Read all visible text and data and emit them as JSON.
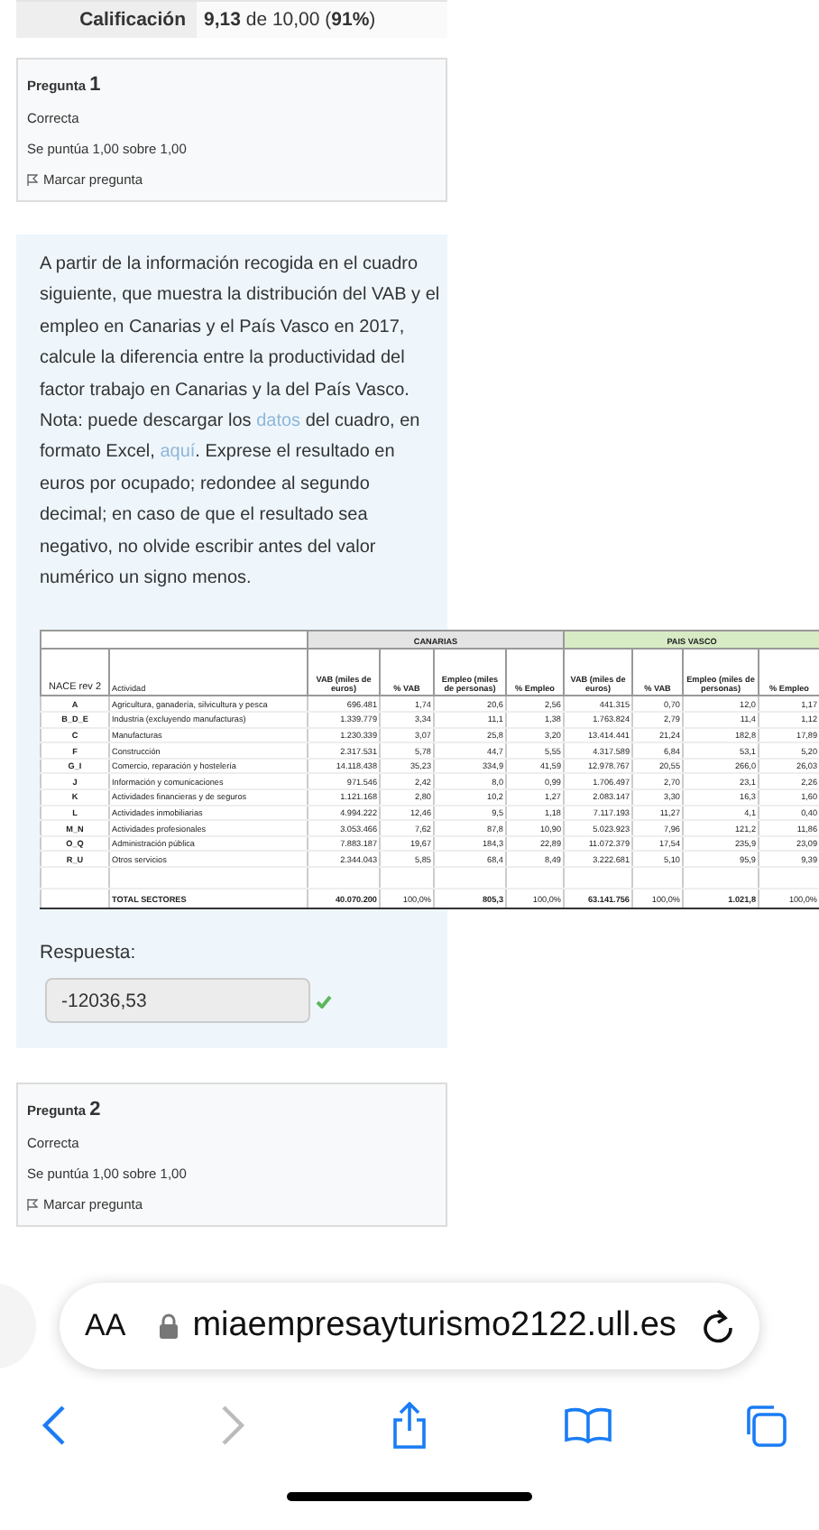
{
  "grade": {
    "label": "Calificación",
    "value": "**9,13** de 10,00 (**91%**)"
  },
  "question1": {
    "label": "Pregunta",
    "number": "1",
    "status": "Correcta",
    "score": "Se puntúa 1,00 sobre 1,00",
    "flag": "Marcar pregunta"
  },
  "prompt": [
    {
      "kind": "text",
      "text": "A partir de la información recogida en el cuadro siguiente, que muestra la distribución del VAB y el empleo en Canarias y el País Vasco en 2017, calcule la diferencia entre la productividad del factor trabajo en Canarias y la del País Vasco. Nota: puede descargar los "
    },
    {
      "kind": "link",
      "text": "datos"
    },
    {
      "kind": "text",
      "text": " del cuadro, en formato Excel, "
    },
    {
      "kind": "link",
      "text": "aquí"
    },
    {
      "kind": "text",
      "text": ". Exprese el resultado en euros por ocupado; redondee al segundo decimal; en caso de que el resultado sea negativo, no olvide escribir antes del valor numérico un signo menos."
    }
  ],
  "table": {
    "groups": [
      {
        "label": "CANARIAS",
        "kind": "grey"
      },
      {
        "label": "PAIS VASCO",
        "kind": "green"
      }
    ],
    "columns": [
      "NACE rev 2",
      "Actividad",
      "VAB (miles de euros)",
      "% VAB",
      "Empleo (miles de personas)",
      "% Empleo",
      "VAB (miles de euros)",
      "% VAB",
      "Empleo (miles de personas)",
      "% Empleo"
    ],
    "rows": [
      [
        "A",
        "Agricultura, ganadería, silvicultura y pesca",
        "696.481",
        "1,74",
        "20,6",
        "2,56",
        "441.315",
        "0,70",
        "12,0",
        "1,17"
      ],
      [
        "B_D_E",
        "Industria (excluyendo manufacturas)",
        "1.339.779",
        "3,34",
        "11,1",
        "1,38",
        "1.763.824",
        "2,79",
        "11,4",
        "1,12"
      ],
      [
        "C",
        "Manufacturas",
        "1.230.339",
        "3,07",
        "25,8",
        "3,20",
        "13.414.441",
        "21,24",
        "182,8",
        "17,89"
      ],
      [
        "F",
        "Construcción",
        "2.317.531",
        "5,78",
        "44,7",
        "5,55",
        "4.317.589",
        "6,84",
        "53,1",
        "5,20"
      ],
      [
        "G_I",
        "Comercio, reparación y hostelería",
        "14.118.438",
        "35,23",
        "334,9",
        "41,59",
        "12.978.767",
        "20,55",
        "266,0",
        "26,03"
      ],
      [
        "J",
        "Información y comunicaciones",
        "971.546",
        "2,42",
        "8,0",
        "0,99",
        "1.706.497",
        "2,70",
        "23,1",
        "2,26"
      ],
      [
        "K",
        "Actividades financieras y de seguros",
        "1.121.168",
        "2,80",
        "10,2",
        "1,27",
        "2.083.147",
        "3,30",
        "16,3",
        "1,60"
      ],
      [
        "L",
        "Actividades inmobiliarias",
        "4.994.222",
        "12,46",
        "9,5",
        "1,18",
        "7.117.193",
        "11,27",
        "4,1",
        "0,40"
      ],
      [
        "M_N",
        "Actividades profesionales",
        "3.053.466",
        "7,62",
        "87,8",
        "10,90",
        "5.023.923",
        "7,96",
        "121,2",
        "11,86"
      ],
      [
        "O_Q",
        "Administración pública",
        "7.883.187",
        "19,67",
        "184,3",
        "22,89",
        "11.072.379",
        "17,54",
        "235,9",
        "23,09"
      ],
      [
        "R_U",
        "Otros servicios",
        "2.344.043",
        "5,85",
        "68,4",
        "8,49",
        "3.222.681",
        "5,10",
        "95,9",
        "9,39"
      ]
    ],
    "total": [
      "TOTAL SECTORES",
      "40.070.200",
      "100,0%",
      "805,3",
      "100,0%",
      "63.141.756",
      "100,0%",
      "1.021,8",
      "100,0%"
    ]
  },
  "answer": {
    "label": "Respuesta:",
    "value": "-12036,53",
    "correct": true
  },
  "question2": {
    "label": "Pregunta",
    "number": "2",
    "status": "Correcta",
    "score": "Se puntúa 1,00 sobre 1,00",
    "flag": "Marcar pregunta"
  },
  "browser": {
    "text_size": "AA",
    "url": "miaempresayturismo2122.ull.es",
    "back_enabled": true,
    "forward_enabled": false
  }
}
